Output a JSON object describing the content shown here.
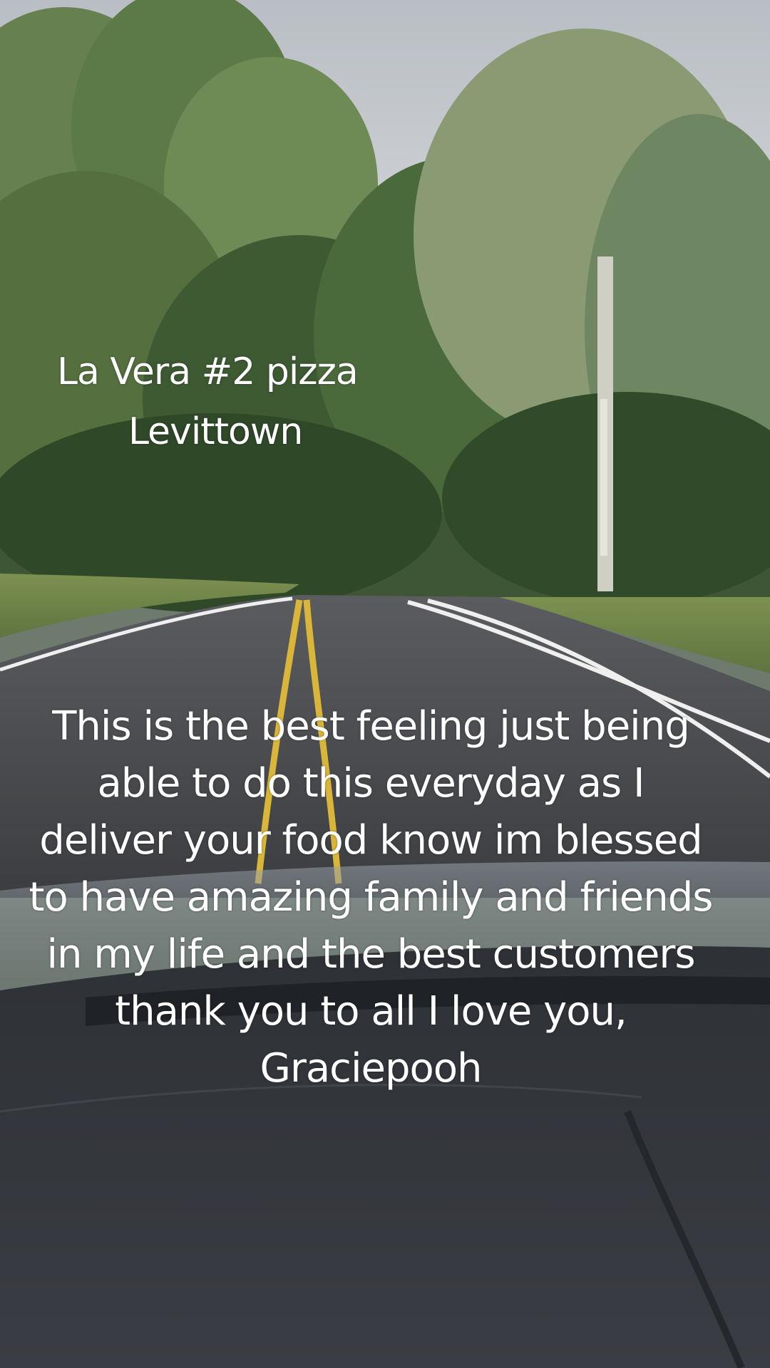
{
  "overlay": {
    "place_line_1": "La Vera #2 pizza",
    "place_line_2": "Levittown",
    "caption": "This is the best feeling just being able to do this everyday as I deliver your food know im blessed to have amazing family and friends in my life and the best customers thank you to all I love you, Graciepooh"
  },
  "colors": {
    "sky": "#c4c8cc",
    "foliage": "#3f5a34",
    "road": "#4a4b4d",
    "center_line": "#d9b53a",
    "edge_line": "#f2f2f2",
    "dashboard": "#2a2d32",
    "text": "#ffffff"
  },
  "icons": {
    "scene": "road-through-park-from-car-dashboard"
  }
}
